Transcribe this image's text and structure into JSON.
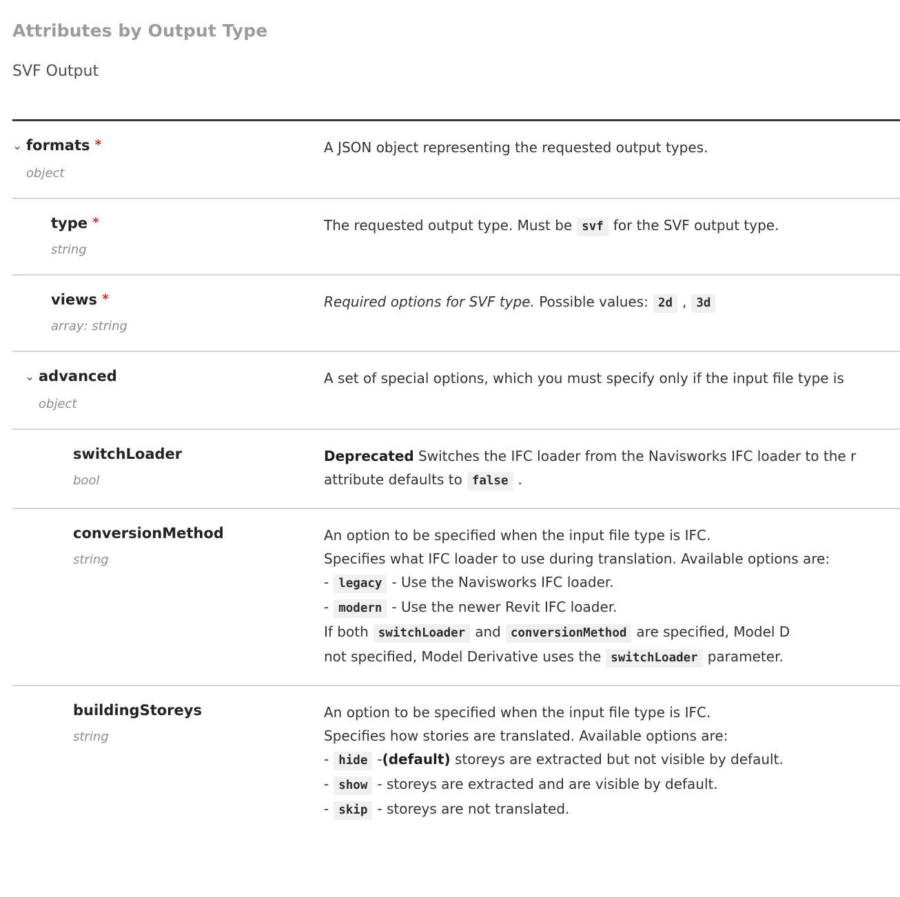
{
  "headings": {
    "section": "Attributes by Output Type",
    "subsection": "SVF Output"
  },
  "icons": {
    "chevron": "⌄",
    "required_marker": "*"
  },
  "colors": {
    "required_asterisk": "#c0392b",
    "section_heading": "#9b9b9b",
    "subsection_heading": "#4c4c4c",
    "body_text": "#2f3234",
    "code_chip_bg": "#f0f0f0",
    "top_rule": "#35383a",
    "row_divider": "#d4d4d4"
  },
  "attributes": [
    {
      "name": "formats",
      "type": "object",
      "required": true,
      "expandable": true,
      "level": 0,
      "desc": {
        "lines": [
          [
            {
              "t": "text",
              "v": "A JSON object representing the requested output types."
            }
          ]
        ]
      }
    },
    {
      "name": "type",
      "type": "string",
      "required": true,
      "expandable": false,
      "level": 1,
      "desc": {
        "lines": [
          [
            {
              "t": "text",
              "v": "The requested output type. Must be"
            },
            {
              "t": "code",
              "v": "svf"
            },
            {
              "t": "text",
              "v": "for the SVF output type."
            }
          ]
        ]
      }
    },
    {
      "name": "views",
      "type": "array: string",
      "required": true,
      "expandable": false,
      "level": 1,
      "desc": {
        "lines": [
          [
            {
              "t": "em",
              "v": "Required options for SVF type."
            },
            {
              "t": "text",
              "v": " Possible values:"
            },
            {
              "t": "code",
              "v": "2d"
            },
            {
              "t": "text",
              "v": ","
            },
            {
              "t": "code",
              "v": "3d"
            }
          ]
        ]
      }
    },
    {
      "name": "advanced",
      "type": "object",
      "required": false,
      "expandable": true,
      "level": "0b",
      "desc": {
        "lines": [
          [
            {
              "t": "text",
              "v": "A set of special options, which you must specify only if the input file type is"
            }
          ]
        ]
      }
    },
    {
      "name": "switchLoader",
      "type": "bool",
      "required": false,
      "expandable": false,
      "level": 2,
      "desc": {
        "lines": [
          [
            {
              "t": "b",
              "v": "Deprecated"
            },
            {
              "t": "text",
              "v": " Switches the IFC loader from the Navisworks IFC loader to the r"
            }
          ],
          [
            {
              "t": "text",
              "v": "attribute defaults to"
            },
            {
              "t": "code",
              "v": "false"
            },
            {
              "t": "text",
              "v": "."
            }
          ]
        ]
      }
    },
    {
      "name": "conversionMethod",
      "type": "string",
      "required": false,
      "expandable": false,
      "level": 2,
      "desc": {
        "lines": [
          [
            {
              "t": "text",
              "v": "An option to be specified when the input file type is IFC."
            }
          ],
          [
            {
              "t": "text",
              "v": "Specifies what IFC loader to use during translation. Available options are:"
            }
          ],
          [
            {
              "t": "text",
              "v": "-"
            },
            {
              "t": "code",
              "v": "legacy"
            },
            {
              "t": "text",
              "v": "- Use the Navisworks IFC loader."
            }
          ],
          [
            {
              "t": "text",
              "v": "-"
            },
            {
              "t": "code",
              "v": "modern"
            },
            {
              "t": "text",
              "v": "- Use the newer Revit IFC loader."
            }
          ],
          [
            {
              "t": "text",
              "v": "If both"
            },
            {
              "t": "code",
              "v": "switchLoader"
            },
            {
              "t": "text",
              "v": "and"
            },
            {
              "t": "code",
              "v": "conversionMethod"
            },
            {
              "t": "text",
              "v": "are specified, Model D"
            }
          ],
          [
            {
              "t": "text",
              "v": "not specified, Model Derivative uses the"
            },
            {
              "t": "code",
              "v": "switchLoader"
            },
            {
              "t": "text",
              "v": "parameter."
            }
          ]
        ]
      }
    },
    {
      "name": "buildingStoreys",
      "type": "string",
      "required": false,
      "expandable": false,
      "level": 2,
      "desc": {
        "lines": [
          [
            {
              "t": "text",
              "v": "An option to be specified when the input file type is IFC."
            }
          ],
          [
            {
              "t": "text",
              "v": "Specifies how stories are translated. Available options are:"
            }
          ],
          [
            {
              "t": "text",
              "v": "-"
            },
            {
              "t": "code",
              "v": "hide"
            },
            {
              "t": "text",
              "v": "-"
            },
            {
              "t": "b",
              "v": "(default)"
            },
            {
              "t": "text",
              "v": " storeys are extracted but not visible by default."
            }
          ],
          [
            {
              "t": "text",
              "v": "-"
            },
            {
              "t": "code",
              "v": "show"
            },
            {
              "t": "text",
              "v": "- storeys are extracted and are visible by default."
            }
          ],
          [
            {
              "t": "text",
              "v": "-"
            },
            {
              "t": "code",
              "v": "skip"
            },
            {
              "t": "text",
              "v": "- storeys are not translated."
            }
          ]
        ]
      }
    }
  ]
}
